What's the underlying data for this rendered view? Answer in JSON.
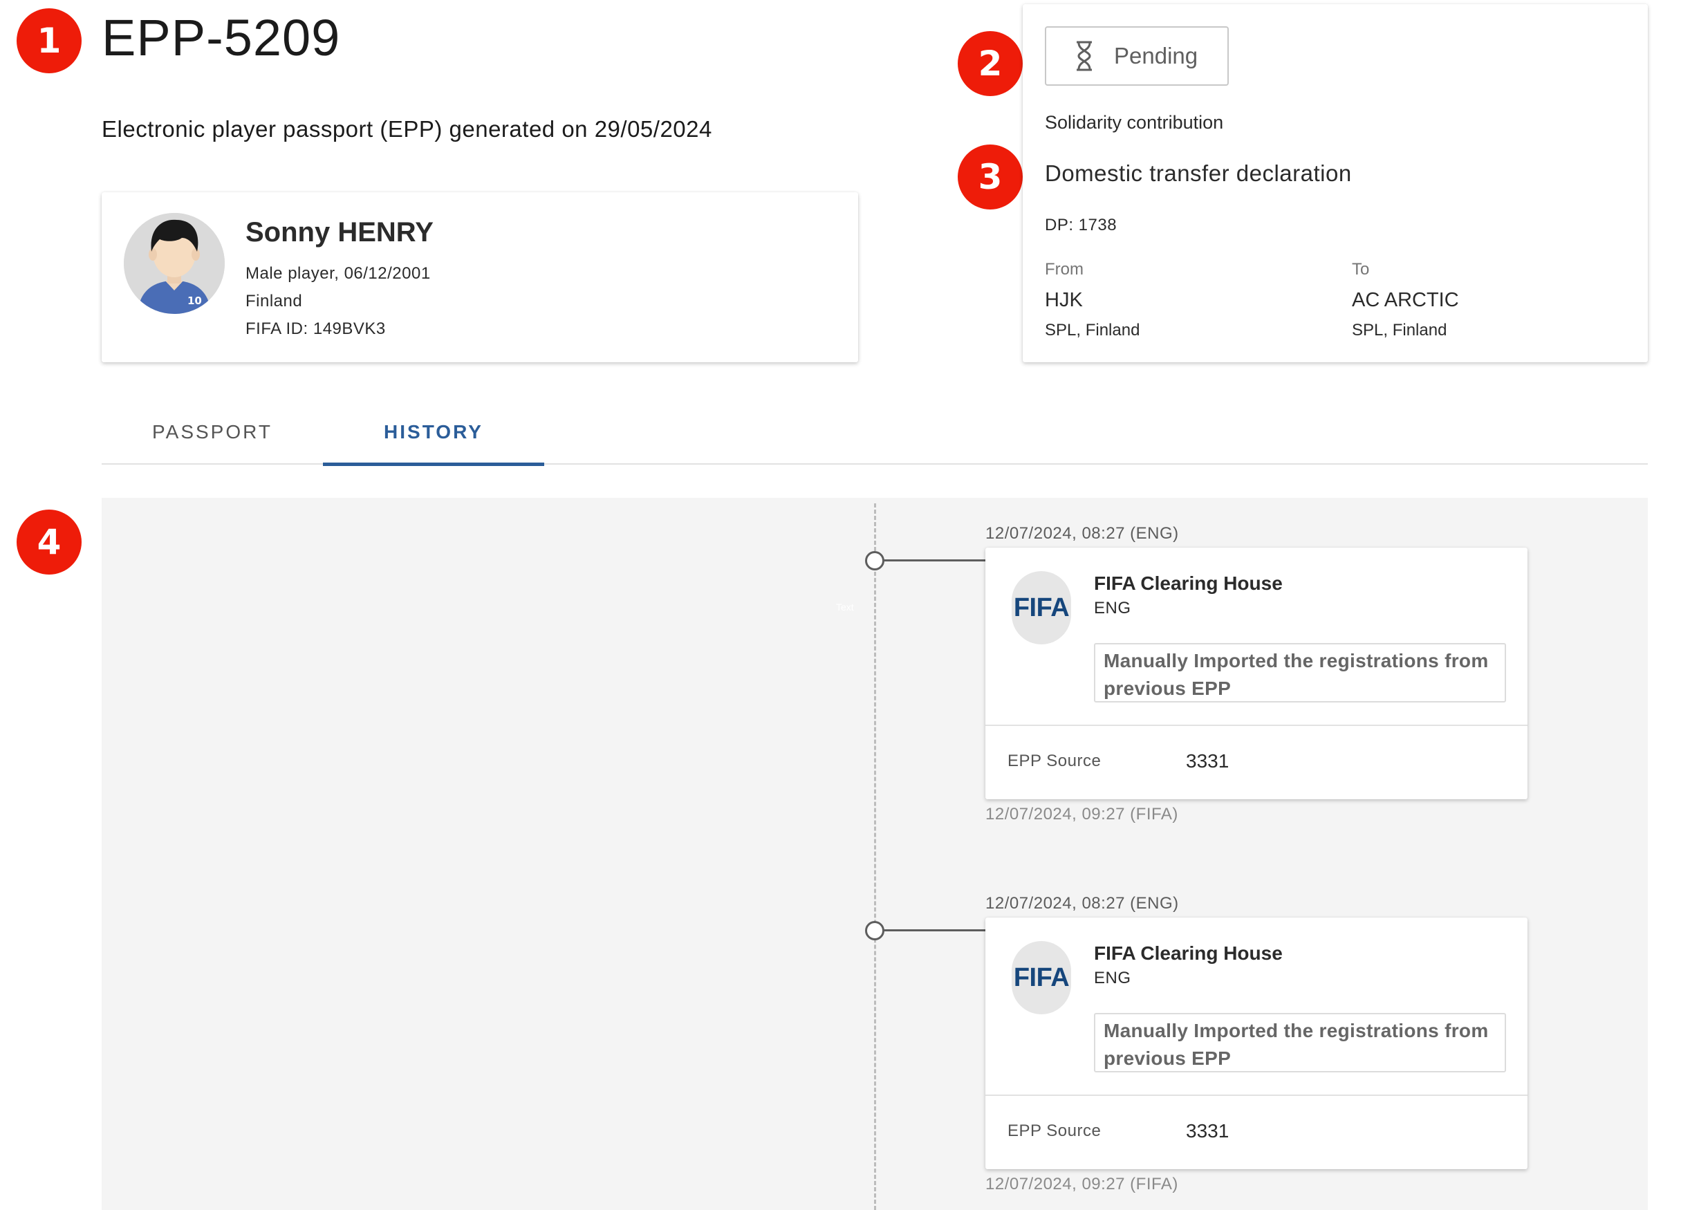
{
  "header": {
    "title": "EPP-5209",
    "subtitle": "Electronic player passport (EPP) generated on 29/05/2024"
  },
  "badges": [
    "1",
    "2",
    "3",
    "4"
  ],
  "player": {
    "name": "Sonny HENRY",
    "details": "Male player, 06/12/2001",
    "country": "Finland",
    "fifa_id": "FIFA ID: 149BVK3",
    "shirt_number": "10"
  },
  "transfer": {
    "status": "Pending",
    "status_icon": "hourglass-icon",
    "type": "Solidarity contribution",
    "declaration": "Domestic transfer declaration",
    "dp": "DP: 1738",
    "from_label": "From",
    "from_club": "HJK",
    "from_league": "SPL, Finland",
    "to_label": "To",
    "to_club": "AC ARCTIC",
    "to_league": "SPL, Finland"
  },
  "tabs": [
    {
      "label": "PASSPORT",
      "active": false
    },
    {
      "label": "HISTORY",
      "active": true
    }
  ],
  "history": {
    "ghost_text": "Text",
    "entries": [
      {
        "time_top": "12/07/2024, 08:27 (ENG)",
        "logo": "FIFA",
        "org": "FIFA Clearing House",
        "country": "ENG",
        "note": "Manually Imported the registrations from previous EPP",
        "source_label": "EPP Source",
        "source_value": "3331",
        "time_bottom": "12/07/2024, 09:27 (FIFA)"
      },
      {
        "time_top": "12/07/2024, 08:27 (ENG)",
        "logo": "FIFA",
        "org": "FIFA Clearing House",
        "country": "ENG",
        "note": "Manually Imported the registrations from previous EPP",
        "source_label": "EPP Source",
        "source_value": "3331",
        "time_bottom": "12/07/2024, 09:27 (FIFA)"
      }
    ]
  },
  "colors": {
    "badge": "#ee1c09",
    "accent": "#2b5d99",
    "fifa_blue": "#16467c",
    "panel_bg": "#f4f4f4"
  }
}
